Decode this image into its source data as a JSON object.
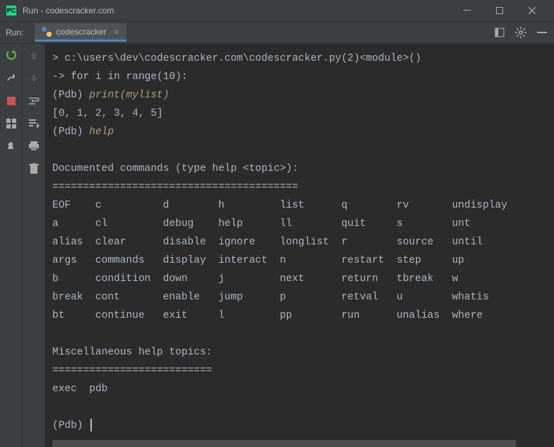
{
  "titlebar": {
    "title": "Run - codescracker.com"
  },
  "toolbar": {
    "run_label": "Run:",
    "tab_label": "codescracker"
  },
  "console": {
    "line1": "> c:\\users\\dev\\codescracker.com\\codescracker.py(2)<module>()",
    "line2": "-> for i in range(10):",
    "line3_pdb": "(Pdb) ",
    "line3_cmd": "print(mylist)",
    "line4": "[0, 1, 2, 3, 4, 5]",
    "line5_pdb": "(Pdb) ",
    "line5_cmd": "help",
    "doc_heading": "Documented commands (type help <topic>):",
    "doc_underline": "========================================",
    "cmd_row1": "EOF    c          d        h         list      q        rv       undisplay",
    "cmd_row2": "a      cl         debug    help      ll        quit     s        unt",
    "cmd_row3": "alias  clear      disable  ignore    longlist  r        source   until",
    "cmd_row4": "args   commands   display  interact  n         restart  step     up",
    "cmd_row5": "b      condition  down     j         next      return   tbreak   w",
    "cmd_row6": "break  cont       enable   jump      p         retval   u        whatis",
    "cmd_row7": "bt     continue   exit     l         pp        run      unalias  where",
    "misc_heading": "Miscellaneous help topics:",
    "misc_underline": "==========================",
    "misc_row": "exec  pdb",
    "prompt": "(Pdb) "
  }
}
